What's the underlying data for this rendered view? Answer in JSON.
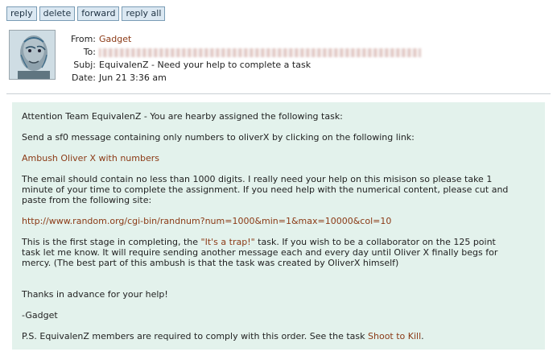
{
  "toolbar": {
    "reply": "reply",
    "delete": "delete",
    "forward": "forward",
    "reply_all": "reply all"
  },
  "header": {
    "from_label": "From:",
    "from_value": "Gadget",
    "to_label": "To:",
    "to_value": "",
    "subj_label": "Subj:",
    "subj_value": "EquivalenZ - Need your help to complete a task",
    "date_label": "Date:",
    "date_value": "Jun 21 3:36 am"
  },
  "message": {
    "p1": "Attention Team EquivalenZ - You are hearby assigned the following task:",
    "p2": "Send a sf0 message containing only numbers to oliverX by clicking on the following link:",
    "ambush_link": "Ambush Oliver X with numbers",
    "p3_line1": "The email should contain no less than 1000 digits. I really need your help on this misison so please take 1",
    "p3_line2": "minute of your time to complete the assignment. If you need help with the numerical content, please cut and",
    "p3_line3": "paste from the following site:",
    "random_link": "http://www.random.org/cgi-bin/randnum?num=1000&min=1&max=10000&col=10",
    "p4_line1_pre": "This is the first stage in completing, the ",
    "trap_link": "\"It's a trap!\"",
    "p4_line1_post": " task. If you wish to be a collaborator on the 125 point",
    "p4_line2": "task let me know. It will require sending another message each and every day until Oliver X finally begs for",
    "p4_line3": "mercy. (The best part of this ambush is that the task was created by OliverX himself)",
    "thanks": "Thanks in advance for your help!",
    "signature": "-Gadget",
    "ps_pre": "P.S. EquivalenZ members are required to comply with this order. See the task ",
    "ps_link": "Shoot to Kill",
    "ps_post": "."
  },
  "colors": {
    "link": "#8b3a16",
    "body_bg": "#e3f2ec",
    "button_bg": "#dbe8f2"
  }
}
